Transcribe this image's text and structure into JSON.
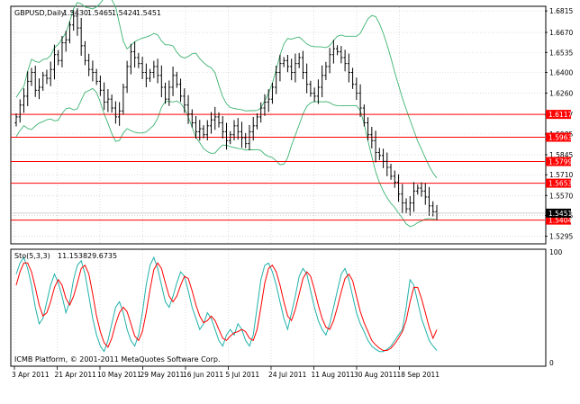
{
  "chart_data": [
    {
      "type": "candlestick",
      "title": "GBPUSD,Daily",
      "ohlc_header": {
        "open": "1.5430",
        "high": "1.5465",
        "low": "1.5424",
        "close": "1.5451"
      },
      "current_price": "1.5451",
      "y_ticks": [
        "1.6815",
        "1.6670",
        "1.6535",
        "1.6400",
        "1.6260",
        "1.6117",
        "1.5985",
        "1.5845",
        "1.5710",
        "1.5570",
        "1.5435",
        "1.5295"
      ],
      "ylim": [
        1.525,
        1.684
      ],
      "horizontal_levels": [
        "1.6117",
        "1.5963",
        "1.5799",
        "1.5653",
        "1.5404"
      ],
      "x_ticks": [
        "3 Apr 2011",
        "21 Apr 2011",
        "10 May 2011",
        "29 May 2011",
        "16 Jun 2011",
        "5 Jul 2011",
        "24 Jul 2011",
        "11 Aug 2011",
        "30 Aug 2011",
        "18 Sep 2011"
      ],
      "bollinger_bands": true,
      "closes": [
        1.61,
        1.618,
        1.624,
        1.634,
        1.64,
        1.628,
        1.63,
        1.638,
        1.636,
        1.642,
        1.652,
        1.648,
        1.66,
        1.662,
        1.672,
        1.678,
        1.67,
        1.658,
        1.648,
        1.642,
        1.64,
        1.634,
        1.628,
        1.62,
        1.622,
        1.616,
        1.61,
        1.614,
        1.63,
        1.644,
        1.654,
        1.65,
        1.646,
        1.64,
        1.636,
        1.64,
        1.644,
        1.638,
        1.63,
        1.622,
        1.63,
        1.638,
        1.632,
        1.624,
        1.618,
        1.612,
        1.606,
        1.6,
        1.602,
        1.598,
        1.604,
        1.608,
        1.61,
        1.606,
        1.6,
        1.594,
        1.598,
        1.604,
        1.6,
        1.596,
        1.592,
        1.6,
        1.604,
        1.61,
        1.616,
        1.62,
        1.622,
        1.63,
        1.64,
        1.646,
        1.648,
        1.644,
        1.64,
        1.646,
        1.65,
        1.64,
        1.632,
        1.626,
        1.624,
        1.63,
        1.638,
        1.644,
        1.652,
        1.656,
        1.654,
        1.65,
        1.646,
        1.64,
        1.632,
        1.626,
        1.616,
        1.606,
        1.598,
        1.594,
        1.586,
        1.584,
        1.58,
        1.576,
        1.57,
        1.566,
        1.558,
        1.552,
        1.548,
        1.552,
        1.56,
        1.562,
        1.56,
        1.556,
        1.55,
        1.546,
        1.545
      ],
      "stochastic": {
        "label": "Sto(5,3,3)",
        "main_value": "11.1538",
        "signal_value": "29.6735",
        "ylim": [
          0,
          100
        ],
        "y_ticks": [
          "100",
          "0"
        ],
        "main": [
          80,
          90,
          95,
          85,
          70,
          50,
          35,
          40,
          55,
          70,
          80,
          72,
          60,
          45,
          55,
          75,
          88,
          92,
          80,
          60,
          40,
          25,
          15,
          10,
          20,
          35,
          50,
          55,
          45,
          30,
          20,
          15,
          25,
          45,
          70,
          88,
          95,
          85,
          70,
          55,
          50,
          60,
          72,
          82,
          78,
          65,
          50,
          40,
          30,
          35,
          45,
          40,
          30,
          20,
          15,
          25,
          30,
          25,
          35,
          30,
          20,
          15,
          25,
          50,
          75,
          88,
          90,
          82,
          70,
          55,
          40,
          30,
          45,
          60,
          78,
          85,
          80,
          65,
          50,
          38,
          30,
          25,
          35,
          50,
          65,
          80,
          85,
          75,
          60,
          45,
          35,
          28,
          20,
          15,
          12,
          10,
          10,
          12,
          15,
          20,
          25,
          30,
          50,
          75,
          70,
          55,
          40,
          30,
          20,
          15,
          11
        ],
        "signal": [
          70,
          82,
          90,
          90,
          82,
          68,
          52,
          42,
          45,
          55,
          68,
          75,
          70,
          58,
          52,
          60,
          72,
          85,
          88,
          80,
          62,
          42,
          28,
          18,
          14,
          22,
          35,
          45,
          50,
          46,
          35,
          24,
          20,
          28,
          45,
          66,
          84,
          90,
          85,
          72,
          60,
          55,
          60,
          70,
          78,
          76,
          65,
          52,
          42,
          36,
          38,
          42,
          38,
          30,
          22,
          20,
          24,
          27,
          28,
          30,
          28,
          22,
          20,
          30,
          50,
          72,
          85,
          88,
          82,
          70,
          55,
          42,
          38,
          48,
          62,
          76,
          82,
          78,
          66,
          52,
          40,
          32,
          30,
          38,
          50,
          64,
          76,
          80,
          74,
          60,
          46,
          36,
          28,
          20,
          16,
          13,
          11,
          11,
          13,
          17,
          22,
          28,
          38,
          55,
          68,
          68,
          58,
          45,
          32,
          22,
          29.6735
        ]
      },
      "watermark": "ICMB Platform, © 2001-2011 MetaQuotes Software Corp."
    }
  ]
}
